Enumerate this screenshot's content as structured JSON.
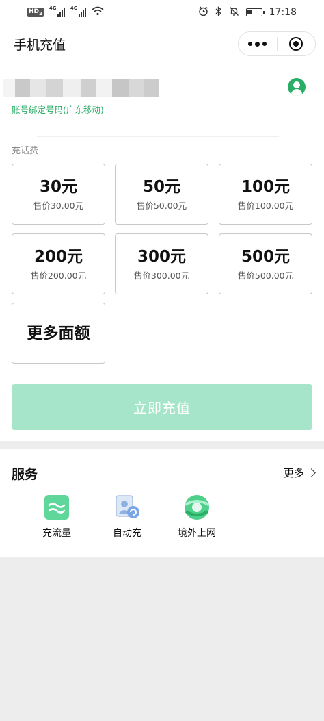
{
  "status_bar": {
    "hd": "HD",
    "hd_sub": "2",
    "net1": "4G",
    "net2": "4G",
    "time": "17:18",
    "battery_level": 0.3
  },
  "nav": {
    "title": "手机充值"
  },
  "account": {
    "phone_masked": true,
    "note": "账号绑定号码(广东移动)"
  },
  "topup": {
    "section_label": "充话费",
    "options": [
      {
        "amount": "30元",
        "price": "售价30.00元"
      },
      {
        "amount": "50元",
        "price": "售价50.00元"
      },
      {
        "amount": "100元",
        "price": "售价100.00元"
      },
      {
        "amount": "200元",
        "price": "售价200.00元"
      },
      {
        "amount": "300元",
        "price": "售价300.00元"
      },
      {
        "amount": "500元",
        "price": "售价500.00元"
      }
    ],
    "more_label": "更多面额",
    "submit_label": "立即充值"
  },
  "services": {
    "title": "服务",
    "more_label": "更多",
    "items": [
      {
        "label": "充流量",
        "icon": "data-plan-icon"
      },
      {
        "label": "自动充",
        "icon": "auto-recharge-icon"
      },
      {
        "label": "境外上网",
        "icon": "roaming-globe-icon"
      }
    ]
  },
  "colors": {
    "accent_green": "#2aae67",
    "button_disabled": "#a6e5ca",
    "background": "#ededed"
  }
}
